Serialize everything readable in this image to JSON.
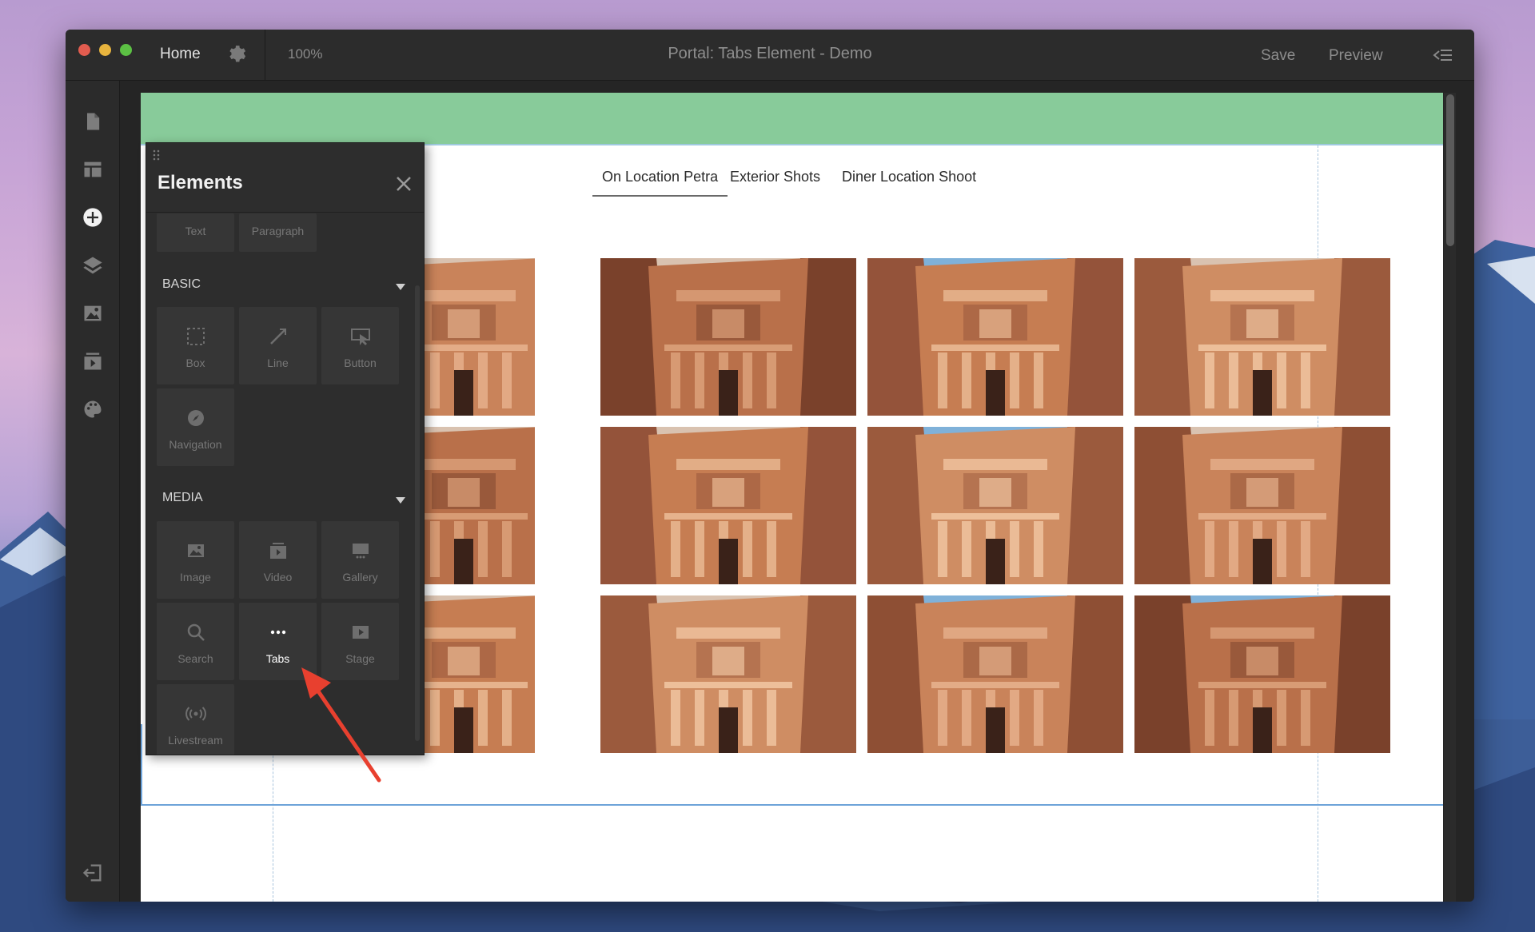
{
  "window": {
    "home_label": "Home",
    "zoom": "100%",
    "title": "Portal: Tabs Element - Demo",
    "save_label": "Save",
    "preview_label": "Preview"
  },
  "left_toolbar": [
    "page-icon",
    "layout-icon",
    "add-element-icon",
    "layers-icon",
    "image-icon",
    "media-icon",
    "palette-icon",
    "exit-icon"
  ],
  "tabs": [
    {
      "label": "On Location Petra",
      "active": true
    },
    {
      "label": "Exterior Shots",
      "active": false
    },
    {
      "label": "Diner Location Shoot",
      "active": false
    }
  ],
  "elements_panel": {
    "title": "Elements",
    "top_items": [
      "Text",
      "Paragraph"
    ],
    "sections": [
      {
        "name": "BASIC",
        "items": [
          "Box",
          "Line",
          "Button",
          "Navigation"
        ]
      },
      {
        "name": "MEDIA",
        "items": [
          "Image",
          "Video",
          "Gallery",
          "Search",
          "Tabs",
          "Stage",
          "Livestream"
        ]
      }
    ]
  },
  "colors": {
    "header_band": "#88cb9a",
    "selection_outline": "#6da3d9",
    "arrow": "#e8402f",
    "window_bg": "#252525"
  }
}
